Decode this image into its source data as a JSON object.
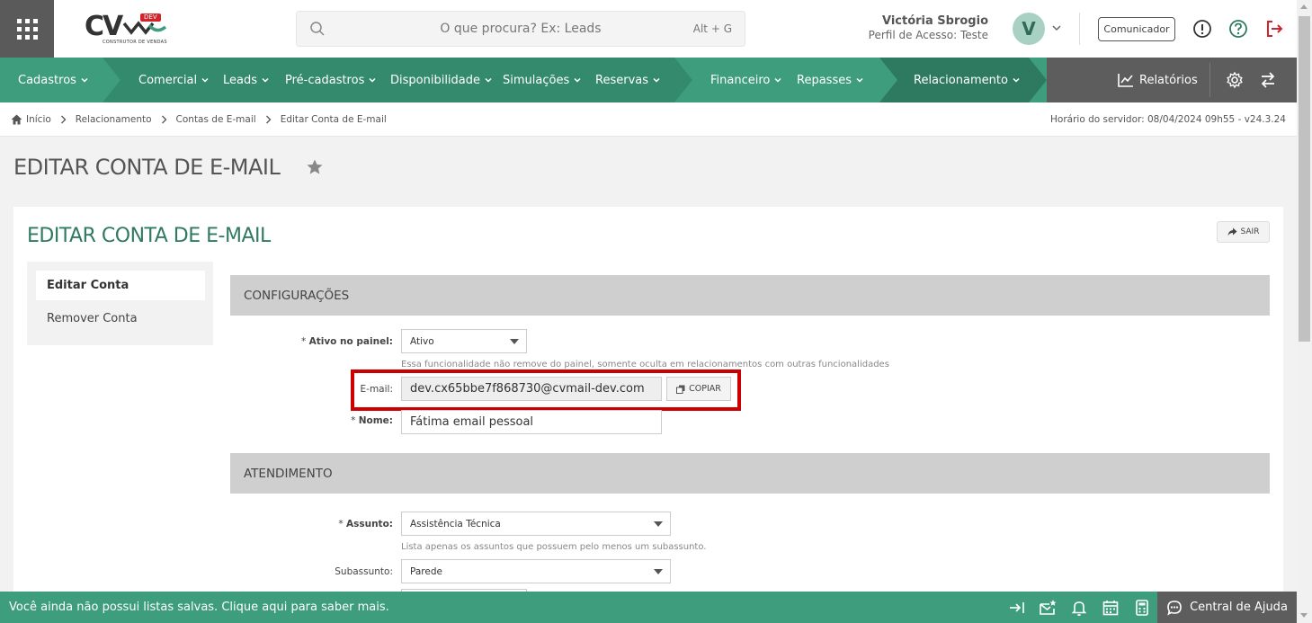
{
  "header": {
    "logo_text": "CV",
    "logo_badge": "DEV",
    "logo_subtitle": "CONSTRUTOR DE VENDAS",
    "search_placeholder": "O que procura? Ex: Leads",
    "search_shortcut": "Alt + G",
    "user_name": "Victória Sbrogio",
    "user_profile": "Perfil de Acesso: Teste",
    "avatar_initial": "V",
    "comunicador_label": "Comunicador",
    "icons": [
      "apps-grid-icon",
      "search-icon",
      "chevron-down-icon",
      "info-icon",
      "help-icon",
      "logout-icon"
    ]
  },
  "nav": {
    "items": [
      {
        "label": "Cadastros"
      },
      {
        "label": "Comercial"
      },
      {
        "label": "Leads"
      },
      {
        "label": "Pré-cadastros"
      },
      {
        "label": "Disponibilidade"
      },
      {
        "label": "Simulações"
      },
      {
        "label": "Reservas"
      },
      {
        "label": "Financeiro"
      },
      {
        "label": "Repasses"
      },
      {
        "label": "Relacionamento"
      }
    ],
    "reports_label": "Relatórios",
    "colors": {
      "primary": "#3e9d7c",
      "dark": "#2e7a60",
      "mid": "#348a6c",
      "gray": "#5d5d5d"
    }
  },
  "breadcrumb": {
    "items": [
      "Início",
      "Relacionamento",
      "Contas de E-mail",
      "Editar Conta de E-mail"
    ],
    "server_time": "Horário do servidor: 08/04/2024 09h55 - v24.3.24"
  },
  "page": {
    "title": "EDITAR CONTA DE E-MAIL",
    "card_title": "EDITAR CONTA DE E-MAIL",
    "exit_label": "SAIR"
  },
  "sidebar": {
    "items": [
      {
        "label": "Editar Conta",
        "active": true
      },
      {
        "label": "Remover Conta",
        "active": false
      }
    ]
  },
  "form": {
    "sections": {
      "config": "CONFIGURAÇÕES",
      "atendimento": "ATENDIMENTO"
    },
    "ativo": {
      "label": "Ativo no painel:",
      "value": "Ativo",
      "hint": "Essa funcionalidade não remove do painel, somente oculta em relacionamentos com outras funcionalidades"
    },
    "email": {
      "label": "E-mail:",
      "value": "dev.cx65bbe7f868730@cvmail-dev.com",
      "copy_label": "COPIAR"
    },
    "nome": {
      "label": "Nome:",
      "value": "Fátima email pessoal"
    },
    "assunto": {
      "label": "Assunto:",
      "value": "Assistência Técnica",
      "hint": "Lista apenas os assuntos que possuem pelo menos um subassunto."
    },
    "subassunto": {
      "label": "Subassunto:",
      "value": "Parede"
    },
    "required_mark": "*"
  },
  "footer": {
    "message": "Você ainda não possui listas salvas. Clique aqui para saber mais.",
    "help_label": "Central de Ajuda",
    "icons": [
      "collapse-right-icon",
      "mail-star-icon",
      "bell-icon",
      "calendar-icon",
      "calculator-icon",
      "chat-icon"
    ]
  }
}
